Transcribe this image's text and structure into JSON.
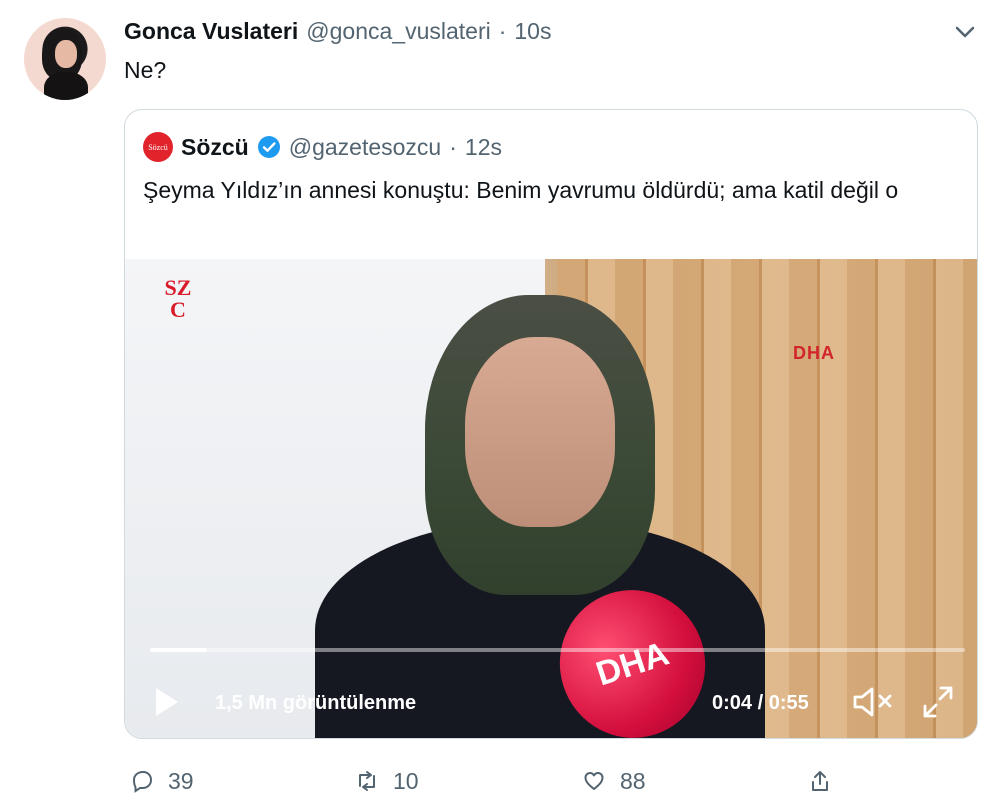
{
  "tweet": {
    "author_name": "Gonca Vuslateri",
    "handle": "@gonca_vuslateri",
    "separator": "·",
    "time": "10s",
    "text": "Ne?",
    "avatar_icon": "profile-photo"
  },
  "quote": {
    "logo_text": "Sözcü",
    "author_name": "Sözcü",
    "handle": "@gazetesozcu",
    "separator": "·",
    "time": "12s",
    "text": "Şeyma Yıldız’ın annesi konuştu: Benim yavrumu öldürdü; ama katil değil o"
  },
  "video": {
    "overlay_logo_text": "SZ\nC",
    "watermark": "DHA",
    "mic_text": "DHA",
    "views": "1,5 Mn görüntülenme",
    "elapsed": "0:04",
    "duration": "0:55",
    "time_separator": " / ",
    "progress": 0.07
  },
  "actions": {
    "replies": "39",
    "retweets": "10",
    "likes": "88"
  },
  "colors": {
    "text": "#0f1419",
    "muted": "#536471",
    "verified": "#1d9bf0",
    "sozcu_red": "#e1242b"
  }
}
